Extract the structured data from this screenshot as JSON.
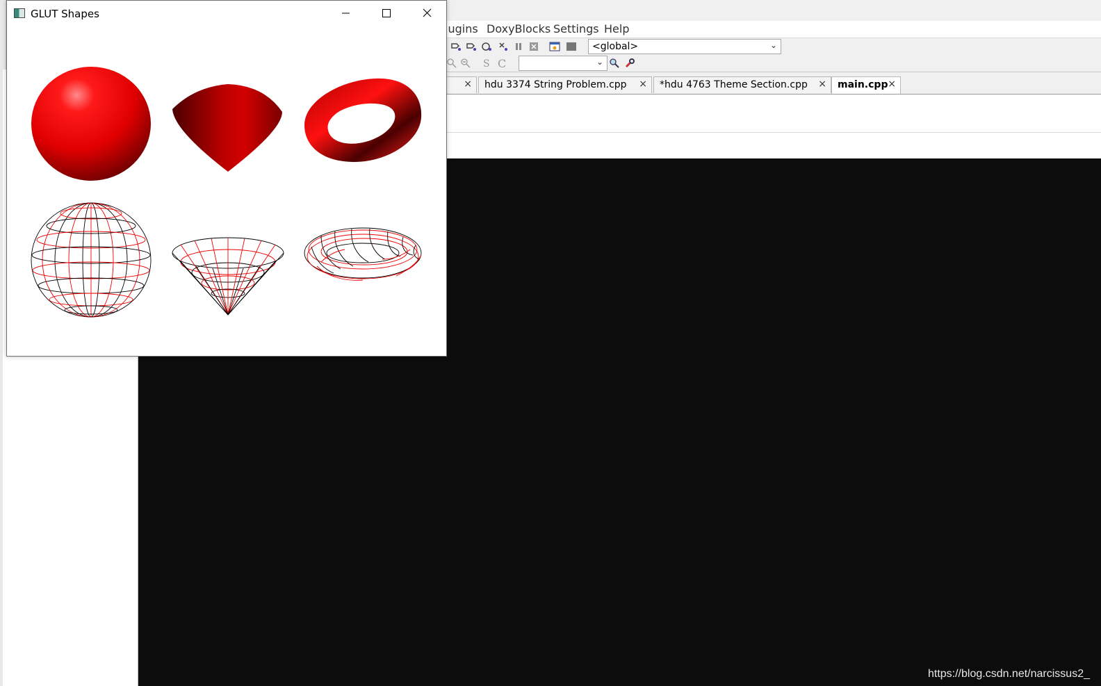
{
  "glut_window": {
    "title": "GLUT Shapes",
    "buttons": [
      "minimize",
      "maximize",
      "close"
    ]
  },
  "ide": {
    "menu": {
      "items": [
        {
          "label": "lugins"
        },
        {
          "label": "DoxyBlocks"
        },
        {
          "label": "Settings"
        },
        {
          "label": "Help"
        }
      ]
    },
    "toolbar": {
      "scope_combo_value": "<global>",
      "search_combo_value": ""
    },
    "tabs": [
      {
        "label": ""
      },
      {
        "label": "hdu 3374 String Problem.cpp"
      },
      {
        "label": "*hdu 4763 Theme Section.cpp"
      },
      {
        "label": "main.cpp",
        "active": true
      }
    ],
    "console": {
      "background": "#0c0c0c"
    },
    "watermark": "https://blog.csdn.net/narcissus2_"
  },
  "colors": {
    "shape_red": "#ff0000",
    "wire_black": "#000000"
  }
}
